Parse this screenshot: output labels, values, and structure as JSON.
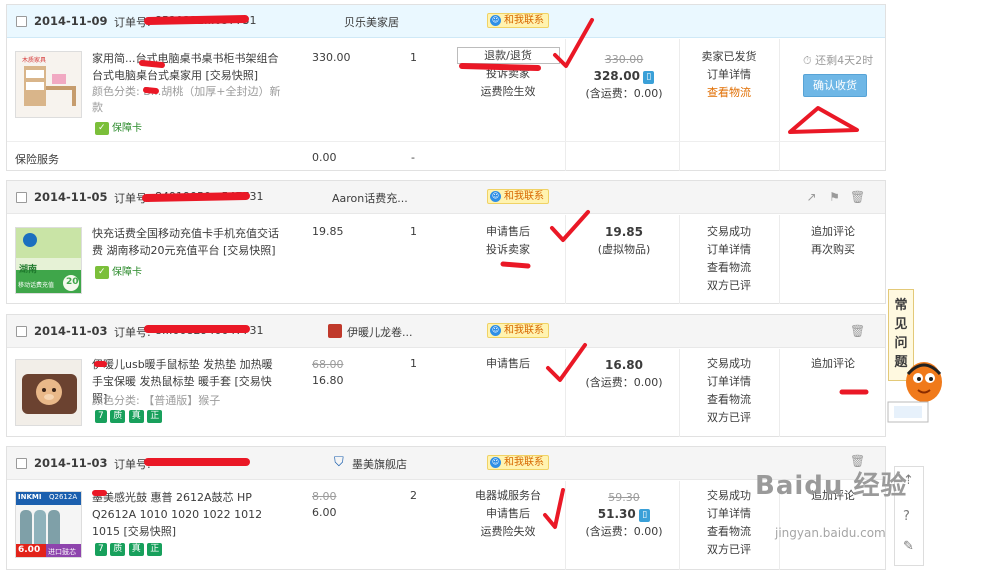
{
  "colors": {
    "accent": "#6fb7e6",
    "pen": "#ea1826",
    "tag_orange": "#e06d00",
    "tag_green": "#18a05c",
    "wang_bg": "#fff3b0"
  },
  "common": {
    "order_label": "订单号:",
    "contact": "和我联系",
    "insurance_card": "保障卡",
    "faq": [
      "常",
      "见",
      "问",
      "题"
    ]
  },
  "orders": [
    {
      "date": "2014-11-09",
      "order_number": "8520332...057731",
      "shop": "贝乐美家居",
      "product": "家用简...台式电脑桌书桌书柜书架组合 台式电脑桌台式桌家用 [交易快照]",
      "variant": "颜色分类: B...胡桃（加厚+全封边）新款",
      "price": "330.00",
      "qty": "1",
      "actions": [
        "退款/退货",
        "投诉卖家",
        "运费险生效"
      ],
      "total_old": "330.00",
      "total": "328.00",
      "total_note": "(含运费：0.00)",
      "status": [
        "卖家已发货",
        "订单详情",
        "查看物流"
      ],
      "countdown": "还剩4天2时",
      "confirm": "确认收货",
      "insurance_label": "保险服务",
      "insurance_price": "0.00",
      "insurance_qty": "-"
    },
    {
      "date": "2014-11-05",
      "order_number": "84919050...547731",
      "shop": "Aaron话费充...",
      "product": "快充话费全国移动充值卡手机充值交话费 湖南移动20元充值平台 [交易快照]",
      "price": "19.85",
      "qty": "1",
      "actions": [
        "申请售后",
        "投诉卖家"
      ],
      "total": "19.85",
      "total_note": "(虚拟物品)",
      "status": [
        "交易成功",
        "订单详情",
        "查看物流",
        "双方已评"
      ],
      "ops": [
        "追加评论",
        "再次购买"
      ],
      "thumb_text": [
        "湖南",
        "移动话费充值",
        "20"
      ]
    },
    {
      "date": "2014-11-03",
      "order_number": "8...0082940047731",
      "shop": "伊暖儿龙卷...",
      "product": "伊暖儿usb暖手鼠标垫 发热垫 加热暖手宝保暖 发热鼠标垫 暖手套 [交易快照]",
      "variant": "颜色分类: 【普通版】猴子",
      "price_old": "68.00",
      "price": "16.80",
      "qty": "1",
      "actions": [
        "申请售后"
      ],
      "total": "16.80",
      "total_note": "(含运费：0.00)",
      "status": [
        "交易成功",
        "订单详情",
        "查看物流",
        "双方已评"
      ],
      "ops": [
        "追加评论"
      ]
    },
    {
      "date": "2014-11-03",
      "order_number": "84...5777731",
      "shop": "墨美旗舰店",
      "product": "墨美感光鼓 惠普 2612A鼓芯 HP Q2612A 1010 1020 1022 1012 1015 [交易快照]",
      "price_old": "8.00",
      "price": "6.00",
      "qty": "2",
      "actions": [
        "电器城服务台",
        "申请售后",
        "运费险失效"
      ],
      "total_old": "59.30",
      "total": "51.30",
      "total_note": "(含运费：0.00)",
      "status": [
        "交易成功",
        "订单详情",
        "查看物流",
        "双方已评"
      ],
      "ops": [
        "追加评论"
      ],
      "thumb_text": [
        "INKMI",
        "Q2612A",
        "6.00",
        "进口鼓芯"
      ]
    }
  ],
  "tags": [
    "7",
    "质",
    "真",
    "正"
  ],
  "watermark": "Baidu 经验",
  "watermark_url": "jingyan.baidu.com"
}
